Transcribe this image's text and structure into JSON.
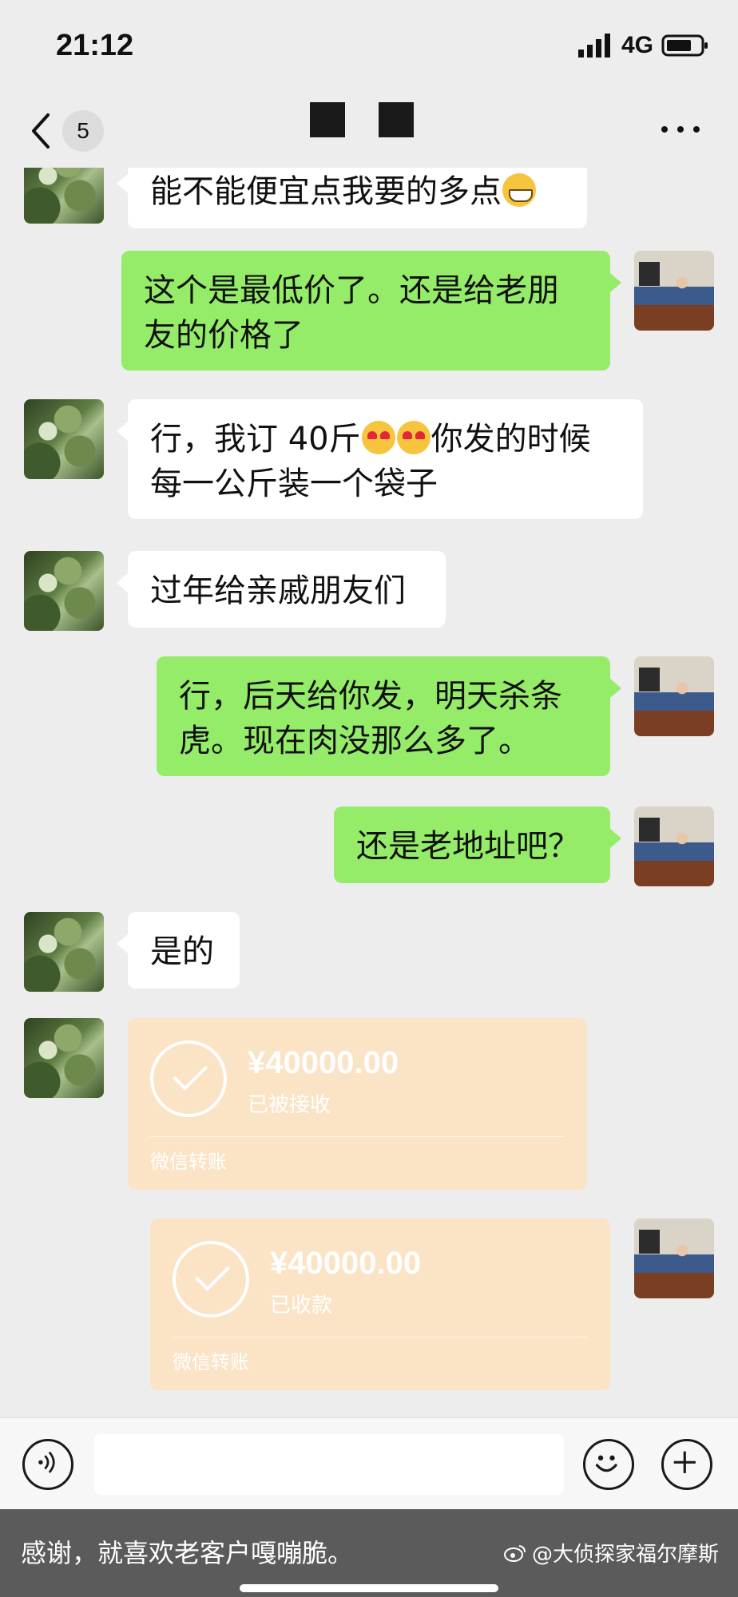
{
  "status_bar": {
    "time": "21:12",
    "network": "4G"
  },
  "nav": {
    "unread_count": "5"
  },
  "messages": [
    {
      "side": "left",
      "text": "能不能便宜点我要的多点"
    },
    {
      "side": "right",
      "text": "这个是最低价了。还是给老朋友的价格了"
    },
    {
      "side": "left",
      "text_part1": "行，我订 40斤",
      "text_part2": "你发的时候每一公斤装一个袋子"
    },
    {
      "side": "left",
      "text": "过年给亲戚朋友们"
    },
    {
      "side": "right",
      "text": "行，后天给你发，明天杀条虎。现在肉没那么多了。"
    },
    {
      "side": "right",
      "text": "还是老地址吧？"
    },
    {
      "side": "left",
      "text": "是的"
    }
  ],
  "transfers": [
    {
      "side": "left",
      "amount": "¥40000.00",
      "status": "已被接收",
      "brand": "微信转账"
    },
    {
      "side": "right",
      "amount": "¥40000.00",
      "status": "已收款",
      "brand": "微信转账"
    }
  ],
  "caption": {
    "text": "感谢，就喜欢老客户嘎嘣脆。",
    "watermark": "@大侦探家福尔摩斯"
  },
  "colors": {
    "sent_bubble": "#95ec69",
    "received_bubble": "#ffffff",
    "transfer_card": "#fbe3c6",
    "background": "#ededed"
  },
  "icons": [
    "back-arrow-icon",
    "more-icon",
    "voice-icon",
    "emoji-icon",
    "plus-icon",
    "weibo-icon"
  ]
}
